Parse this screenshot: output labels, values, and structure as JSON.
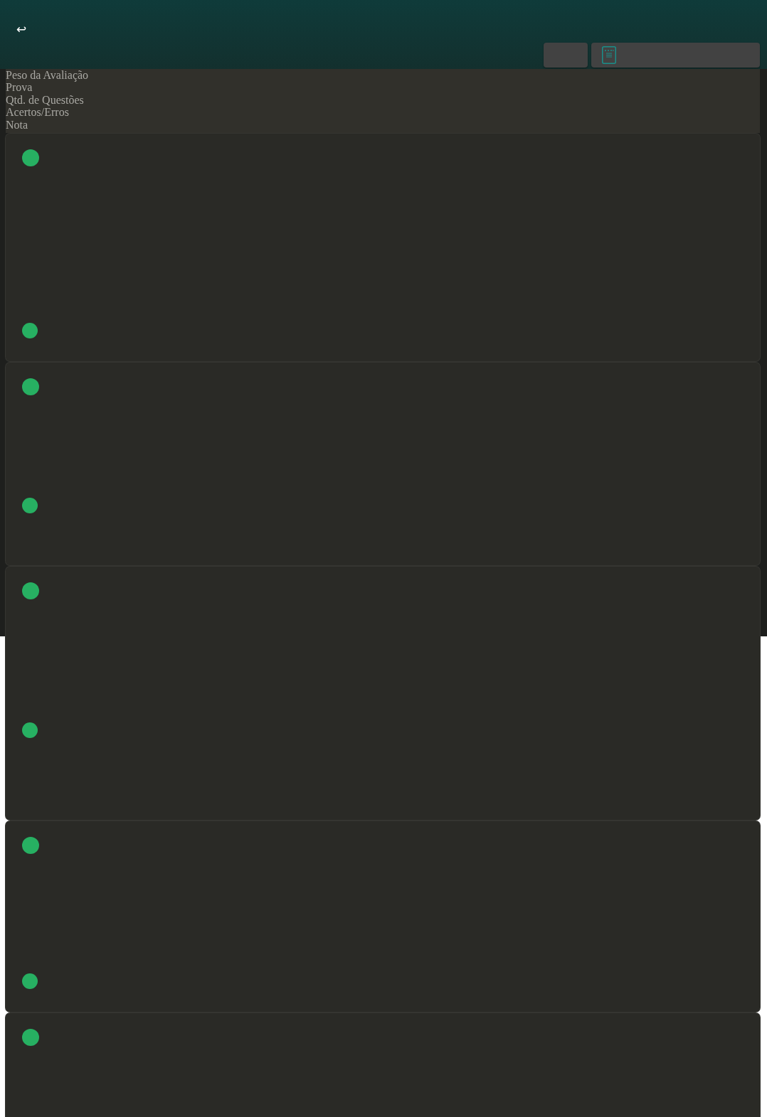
{
  "header": {
    "back_icon": "↩"
  },
  "summary_labels": [
    "Peso da Avaliação",
    "Prova",
    "Qtd. de Questões",
    "Acertos/Erros",
    "Nota"
  ],
  "cards": [
    {
      "markers": [
        {
          "color": "#27b062"
        },
        {
          "color": "#27b062"
        }
      ]
    },
    {
      "markers": [
        {
          "color": "#27b062"
        },
        {
          "color": "#27b062"
        }
      ]
    },
    {
      "markers": [
        {
          "color": "#27b062"
        },
        {
          "color": "#27b062"
        }
      ]
    },
    {
      "markers": [
        {
          "color": "#27b062"
        },
        {
          "color": "#27b062"
        }
      ]
    },
    {
      "markers": [
        {
          "color": "#27b062"
        }
      ]
    }
  ]
}
